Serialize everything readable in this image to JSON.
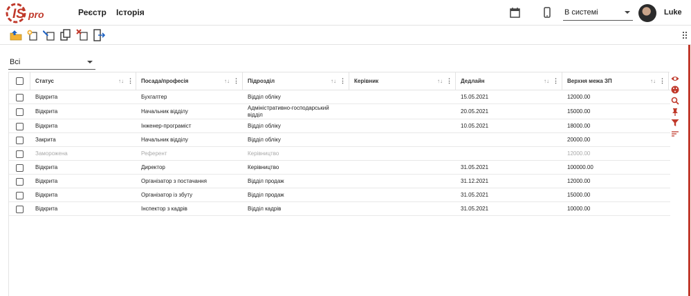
{
  "header": {
    "logo_text": "ISpro",
    "nav": [
      {
        "label": "Реєстр"
      },
      {
        "label": "Історія"
      }
    ],
    "status_select": "В системі",
    "user_name": "Luke"
  },
  "filter": {
    "selected": "Всі"
  },
  "table": {
    "columns": [
      "Статус",
      "Посада/професія",
      "Підрозділ",
      "Керівник",
      "Дедлайн",
      "Верхня межа ЗП"
    ],
    "rows": [
      {
        "status": "Відкрита",
        "position": "Бухгалтер",
        "department": "Відділ обліку",
        "manager": "",
        "deadline": "15.05.2021",
        "salary": "12000.00",
        "dim": false
      },
      {
        "status": "Відкрита",
        "position": "Начальник відділу",
        "department": "Адміністративно-господарський відділ",
        "manager": "",
        "deadline": "20.05.2021",
        "salary": "15000.00",
        "dim": false
      },
      {
        "status": "Відкрита",
        "position": "Інженер-програміст",
        "department": "Відділ обліку",
        "manager": "",
        "deadline": "10.05.2021",
        "salary": "18000.00",
        "dim": false
      },
      {
        "status": "Закрита",
        "position": "Начальник відділу",
        "department": "Відділ обліку",
        "manager": "",
        "deadline": "",
        "salary": "20000.00",
        "dim": false
      },
      {
        "status": "Заморожена",
        "position": "Референт",
        "department": "Керівництво",
        "manager": "",
        "deadline": "",
        "salary": "12000.00",
        "dim": true
      },
      {
        "status": "Відкрита",
        "position": "Директор",
        "department": "Керівництво",
        "manager": "",
        "deadline": "31.05.2021",
        "salary": "100000.00",
        "dim": false
      },
      {
        "status": "Відкрита",
        "position": "Організатор з постачання",
        "department": "Відділ продаж",
        "manager": "",
        "deadline": "31.12.2021",
        "salary": "12000.00",
        "dim": false
      },
      {
        "status": "Відкрита",
        "position": "Організатор із збуту",
        "department": "Відділ продаж",
        "manager": "",
        "deadline": "31.05.2021",
        "salary": "15000.00",
        "dim": false
      },
      {
        "status": "Відкрита",
        "position": "Інспектор з кадрів",
        "department": "Відділ кадрів",
        "manager": "",
        "deadline": "31.05.2021",
        "salary": "10000.00",
        "dim": false
      }
    ]
  },
  "colors": {
    "accent": "#c0392b",
    "dim_text": "#aaaaaa",
    "toolbar_blue": "#1e63c4",
    "toolbar_yellow": "#f2b134"
  },
  "icons": {
    "top": [
      "calendar-icon",
      "mobile-icon"
    ],
    "toolbar": [
      "open-folder-icon",
      "add-record-icon",
      "edit-record-icon",
      "copy-record-icon",
      "delete-record-icon",
      "exit-icon"
    ],
    "side": [
      "eye-icon",
      "palette-icon",
      "search-icon",
      "pin-icon",
      "filter-icon",
      "sort-icon"
    ]
  }
}
